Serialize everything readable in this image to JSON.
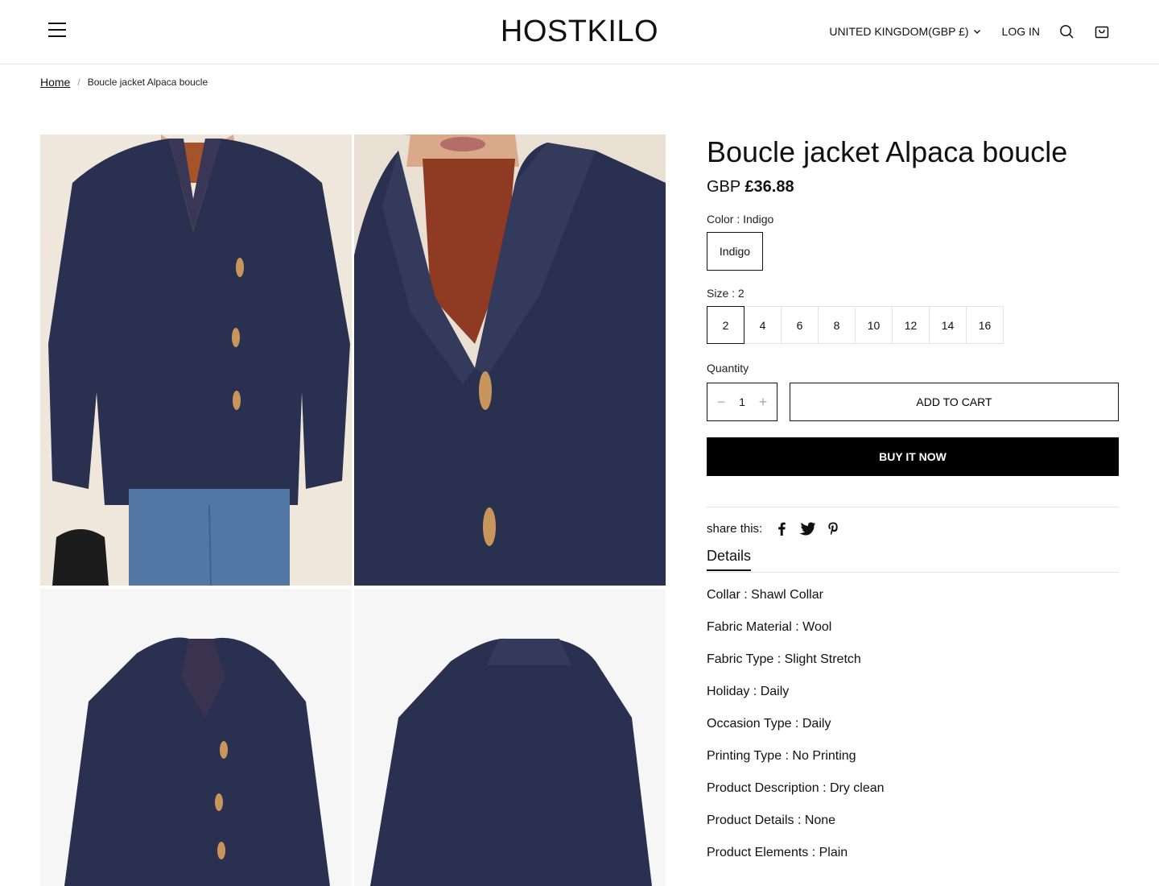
{
  "header": {
    "logo": "HOSTKILO",
    "currency": "UNITED KINGDOM(GBP £)",
    "login": "LOG IN"
  },
  "breadcrumb": {
    "home": "Home",
    "separator": "/",
    "current": "Boucle jacket Alpaca boucle"
  },
  "product": {
    "title": "Boucle jacket Alpaca boucle",
    "price_currency": "GBP",
    "price_amount": "£36.88",
    "color_label": "Color : Indigo",
    "colors": [
      "Indigo"
    ],
    "size_label": "Size : 2",
    "sizes": [
      "2",
      "4",
      "6",
      "8",
      "10",
      "12",
      "14",
      "16"
    ],
    "selected_size": "2",
    "quantity_label": "Quantity",
    "quantity": "1",
    "qty_minus": "−",
    "qty_plus": "+",
    "add_to_cart": "ADD TO CART",
    "buy_now": "BUY IT NOW",
    "share_label": "share this:",
    "details_tab": "Details",
    "details": [
      "Collar : Shawl Collar",
      "Fabric Material : Wool",
      "Fabric Type : Slight Stretch",
      "Holiday : Daily",
      "Occasion Type : Daily",
      "Printing Type : No Printing",
      "Product Description : Dry clean",
      "Product Details : None",
      "Product Elements : Plain"
    ]
  },
  "colors": {
    "sweater": "#2a3150",
    "background_warm": "#efe6dc",
    "background_white": "#f6f6f6",
    "accent": "#000000"
  },
  "icons": [
    "menu-icon",
    "chevron-down-icon",
    "search-icon",
    "cart-icon",
    "facebook-icon",
    "twitter-icon",
    "pinterest-icon"
  ]
}
